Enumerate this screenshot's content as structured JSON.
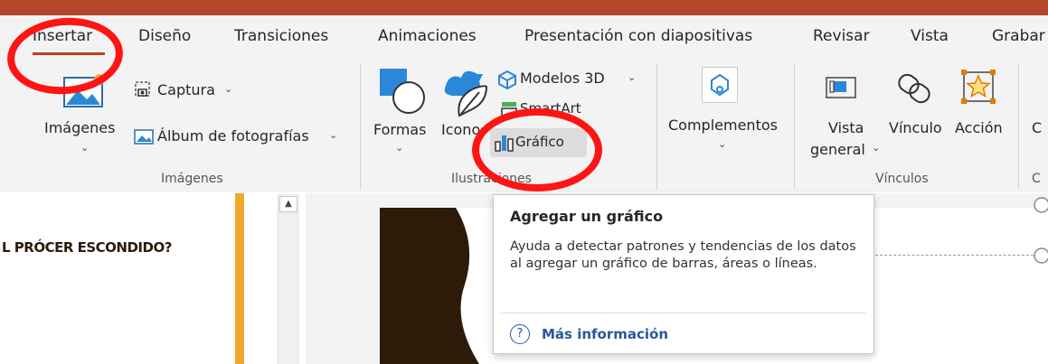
{
  "tabs": [
    "Insertar",
    "Diseño",
    "Transiciones",
    "Animaciones",
    "Presentación con diapositivas",
    "Revisar",
    "Vista",
    "Grabar"
  ],
  "active_tab": "Insertar",
  "images_group": {
    "imagenes_label": "Imágenes",
    "captura_label": "Captura",
    "album_label": "Álbum de fotografías",
    "group_label": "Imágenes"
  },
  "illustrations_group": {
    "formas_label": "Formas",
    "iconos_label": "Iconos",
    "modelos_label": "Modelos 3D",
    "smartart_label": "SmartArt",
    "grafico_label": "Gráfico",
    "group_label": "Ilustraciones"
  },
  "complements_group": {
    "label": "Complementos"
  },
  "links_group": {
    "vista_label_1": "Vista",
    "vista_label_2": "general",
    "vinculo_label": "Vínculo",
    "accion_label": "Acción",
    "group_label": "Vínculos"
  },
  "slide_thumbnail": {
    "title_text": "L PRÓCER ESCONDIDO?"
  },
  "tooltip": {
    "title": "Agregar un gráfico",
    "body": "Ayuda a detectar patrones y tendencias de los datos al agregar un gráfico de barras, áreas o líneas.",
    "link": "Más información"
  },
  "colors": {
    "accent": "#b7472a",
    "highlight_circle": "#ff1414",
    "link": "#2b579a"
  }
}
